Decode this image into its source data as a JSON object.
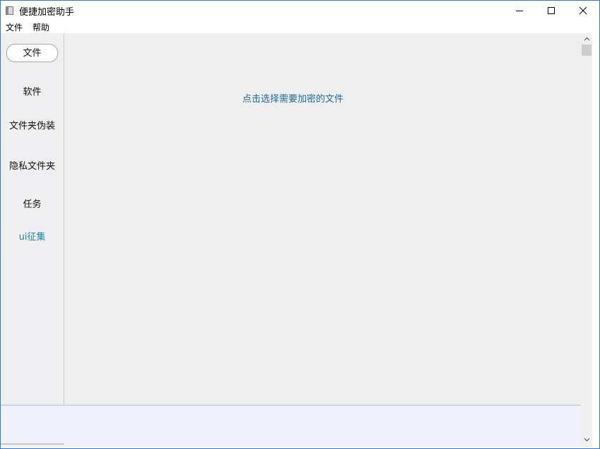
{
  "window": {
    "title": "便捷加密助手"
  },
  "menu": {
    "items": [
      "文件",
      "帮助"
    ]
  },
  "sidebar": {
    "items": [
      {
        "label": "文件",
        "active": true
      },
      {
        "label": "软件"
      },
      {
        "label": "文件夹伪装"
      },
      {
        "label": "隐私文件夹"
      },
      {
        "label": "任务"
      },
      {
        "label": "ui征集"
      }
    ]
  },
  "main": {
    "hint": "点击选择需要加密的文件"
  },
  "icons": [
    "app-icon",
    "minimize-icon",
    "maximize-icon",
    "close-icon",
    "scroll-up-icon",
    "scroll-down-icon"
  ],
  "colors": {
    "window_border": "#2b7bd0",
    "link": "#1a6aa0",
    "accent": "#1a84b0",
    "sidebar_bg": "#efeff1",
    "main_bg": "#f0eff0"
  }
}
